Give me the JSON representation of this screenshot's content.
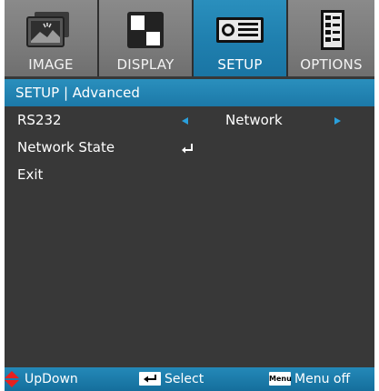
{
  "tabs": [
    {
      "label": "IMAGE",
      "icon": "image-icon",
      "active": false
    },
    {
      "label": "DISPLAY",
      "icon": "display-icon",
      "active": false
    },
    {
      "label": "SETUP",
      "icon": "projector-icon",
      "active": true
    },
    {
      "label": "OPTIONS",
      "icon": "options-icon",
      "active": false
    }
  ],
  "section": {
    "title": "SETUP | Advanced"
  },
  "menu": {
    "rs232": {
      "label": "RS232",
      "value": "Network"
    },
    "network_state": {
      "label": "Network State"
    },
    "exit": {
      "label": "Exit"
    }
  },
  "footer": {
    "updown": "UpDown",
    "select": "Select",
    "menu_key": "Menu",
    "menu_off": "Menu off"
  },
  "colors": {
    "accent": "#1f7fae",
    "panel": "#383838",
    "arrow": "#2aa0dc",
    "updown_icon": "#e8201e"
  }
}
